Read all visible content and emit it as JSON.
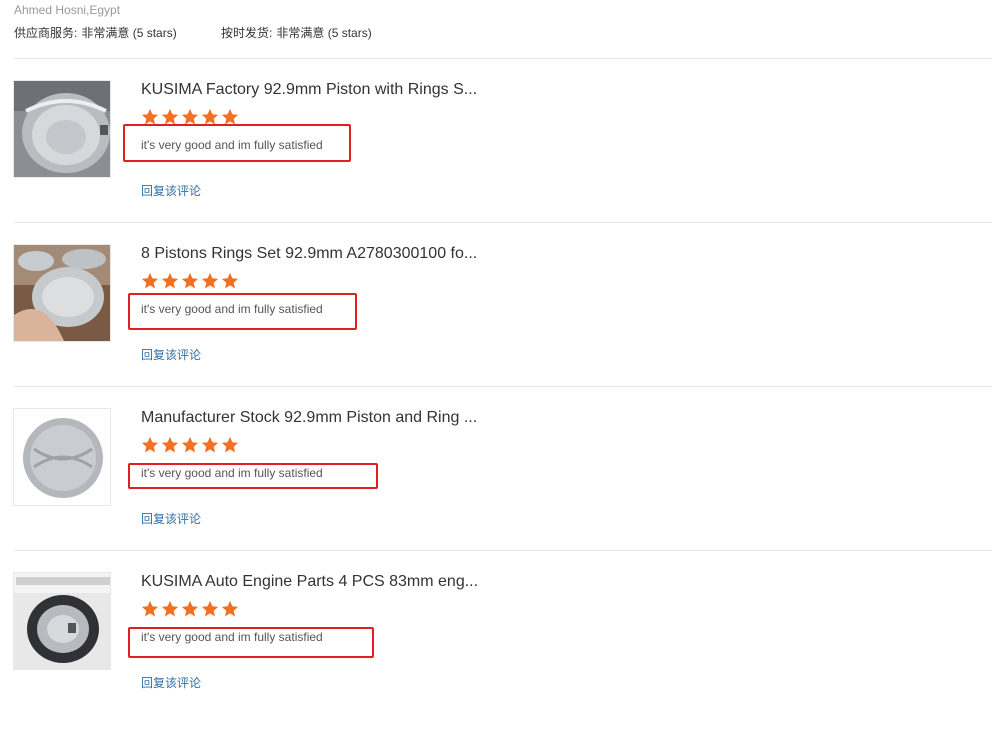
{
  "reviewer": "Ahmed Hosni,Egypt",
  "ratings": {
    "supplier_service": {
      "label": "供应商服务:",
      "value": "非常满意",
      "stars": "(5 stars)"
    },
    "on_time_shipping": {
      "label": "按时发货:",
      "value": "非常满意",
      "stars": "(5 stars)"
    }
  },
  "reviews": [
    {
      "title": "KUSIMA Factory 92.9mm Piston with Rings S...",
      "rating": 5,
      "comment": "it's very good and im fully satisfied",
      "reply": "回复该评论"
    },
    {
      "title": "8 Pistons Rings Set 92.9mm A2780300100 fo...",
      "rating": 5,
      "comment": "it's very good and im fully satisfied",
      "reply": "回复该评论"
    },
    {
      "title": "Manufacturer Stock 92.9mm Piston and Ring ...",
      "rating": 5,
      "comment": "it's very good and im fully satisfied",
      "reply": "回复该评论"
    },
    {
      "title": "KUSIMA Auto Engine Parts 4 PCS 83mm eng...",
      "rating": 5,
      "comment": "it's very good and im fully satisfied",
      "reply": "回复该评论"
    }
  ],
  "colors": {
    "star": "#f36f21",
    "highlight_border": "#e02020",
    "link": "#2e6fa8"
  }
}
